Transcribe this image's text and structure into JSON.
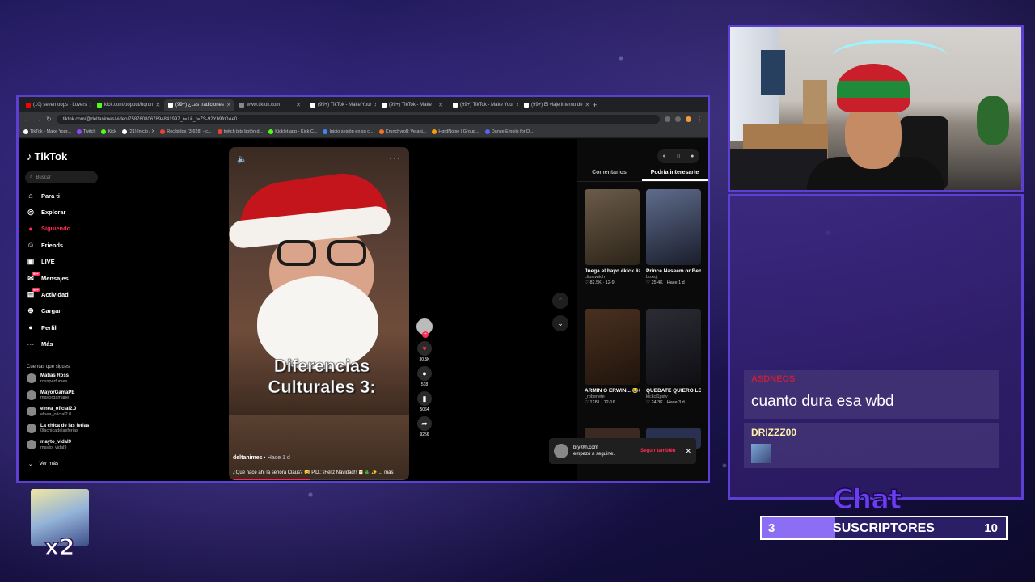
{
  "browser": {
    "tabs": [
      {
        "label": "(10) seven oops - Lovers",
        "color": "#ff0000"
      },
      {
        "label": "kick.com/popout/hqrdn",
        "color": "#53fc18"
      },
      {
        "label": "(99+) ¿Las tradiciones",
        "color": "#ffffff",
        "active": true
      },
      {
        "label": "www.tiktok.com",
        "color": "#888888"
      },
      {
        "label": "(99+) TikTok - Make Your",
        "color": "#ffffff"
      },
      {
        "label": "(99+) TikTok - Make",
        "color": "#ffffff"
      },
      {
        "label": "(99+) TikTok - Make Your",
        "color": "#ffffff"
      },
      {
        "label": "(99+) El viaje interno de",
        "color": "#ffffff"
      }
    ],
    "url": "tiktok.com/@deltanimes/video/7587608067894841997_r=1&_t=ZS-92Yh9frOAe0",
    "bookmarks": [
      {
        "label": "TikTok - Make Your...",
        "color": "#fff"
      },
      {
        "label": "Twitch",
        "color": "#9146ff"
      },
      {
        "label": "Kick",
        "color": "#53fc18"
      },
      {
        "label": "(21) Inicio / X",
        "color": "#fff"
      },
      {
        "label": "Recibidos (3,628) - c...",
        "color": "#ea4335"
      },
      {
        "label": "twitch bits botón d...",
        "color": "#ea4335"
      },
      {
        "label": "Kicklet.app - Kick C...",
        "color": "#53fc18"
      },
      {
        "label": "Inicio sesión en su c...",
        "color": "#4285f4"
      },
      {
        "label": "Crunchyroll: Ve ani...",
        "color": "#f47521"
      },
      {
        "label": "HqrdNoise | Group...",
        "color": "#f4a000"
      },
      {
        "label": "Dance Emojis for Di...",
        "color": "#5865f2"
      }
    ]
  },
  "tiktok": {
    "logo": "TikTok",
    "search_placeholder": "Buscar",
    "nav": [
      {
        "label": "Para ti",
        "icon": "home-icon",
        "glyph": "⌂"
      },
      {
        "label": "Explorar",
        "icon": "compass-icon",
        "glyph": "◎"
      },
      {
        "label": "Siguiendo",
        "icon": "following-icon",
        "glyph": "●",
        "active": true
      },
      {
        "label": "Friends",
        "icon": "friends-icon",
        "glyph": "☺"
      },
      {
        "label": "LIVE",
        "icon": "live-icon",
        "glyph": "▣"
      },
      {
        "label": "Mensajes",
        "icon": "messages-icon",
        "glyph": "✉",
        "badge": "99+"
      },
      {
        "label": "Actividad",
        "icon": "activity-icon",
        "glyph": "▤",
        "badge": "99+"
      },
      {
        "label": "Cargar",
        "icon": "upload-icon",
        "glyph": "⊕"
      },
      {
        "label": "Perfil",
        "icon": "profile-icon",
        "glyph": "●"
      },
      {
        "label": "Más",
        "icon": "more-icon",
        "glyph": "···"
      }
    ],
    "following_title": "Cuentas que sigues",
    "following": [
      {
        "name": "Matias Ross",
        "handle": "rossperfumes"
      },
      {
        "name": "MayorGamaPE",
        "handle": "mayorgamape"
      },
      {
        "name": "elnea_oficial2.0",
        "handle": "elnea_oficial2.0"
      },
      {
        "name": "La chica de las ferias",
        "handle": "0lachicadelasferias"
      },
      {
        "name": "mayto_vidal9",
        "handle": "mayto_vidal9"
      }
    ],
    "see_more": "Ver más",
    "video": {
      "caption": "Diferencias Culturales 3:",
      "author": "deltanimes",
      "time": "Hace 1 d",
      "description": "¿Qué hace ahí la señora Claus? 😅 P.D.: ¡Feliz Navidad!! 🎅🎄 ✨ ... más",
      "progress": 0.45
    },
    "actions": [
      {
        "icon": "heart-icon",
        "glyph": "♥",
        "count": "30.5K",
        "color": "#fe2c55"
      },
      {
        "icon": "comment-icon",
        "glyph": "●",
        "count": "518"
      },
      {
        "icon": "bookmark-icon",
        "glyph": "▮",
        "count": "5064"
      },
      {
        "icon": "share-icon",
        "glyph": "➦",
        "count": "9256"
      }
    ],
    "right_tabs": [
      "Comentarios",
      "Podría interesarte"
    ],
    "cards": [
      {
        "title": "Juega el bayo #kick #zairanara...",
        "user": "clipstwitch",
        "meta": "♡ 82.5K · 12-9",
        "c1": "#6b5b4a",
        "c2": "#2c2418"
      },
      {
        "title": "Prince Naseem or Ben Whittaker ...",
        "user": "boxsjt",
        "meta": "♡ 25.4K · Hace 1 d",
        "c1": "#5e6c8c",
        "c2": "#1a1d2b"
      },
      {
        "title": "ARMIN O ERWIN... 😂😂 #shingeki...",
        "user": "_robenete",
        "meta": "♡ 1281 · 12-16",
        "c1": "#4a3020",
        "c2": "#1f140c"
      },
      {
        "title": "QUEDATE QUIERO LE DIJO GERO A...",
        "user": "kickcl1pstv",
        "meta": "♡ 24.3K · Hace 3 d",
        "c1": "#2c2c35",
        "c2": "#0e0e13"
      }
    ],
    "toast": {
      "user": "bry@n.com",
      "text": "empezó a seguirte.",
      "button": "Seguir también"
    }
  },
  "chat": {
    "messages": [
      {
        "user": "ASDNEOS",
        "text": "cuanto dura esa wbd"
      },
      {
        "user": "DRIZZZ00",
        "text": ""
      }
    ],
    "label": "Chat"
  },
  "subs": {
    "label": "SUSCRIPTORES",
    "current": "3",
    "goal": "10",
    "fraction": 0.3
  },
  "multiplier": "x2",
  "colors": {
    "accent": "#5d3fd3",
    "tiktok_red": "#fe2c55"
  }
}
